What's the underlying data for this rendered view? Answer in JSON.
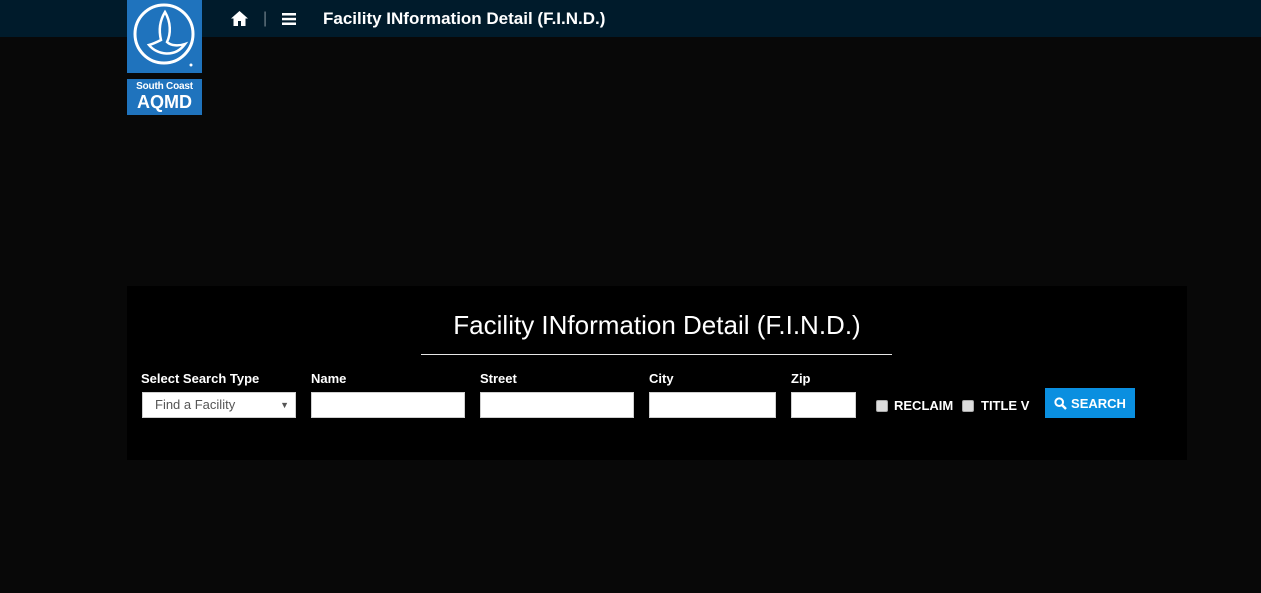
{
  "header": {
    "title": "Facility INformation Detail (F.I.N.D.)",
    "separator": "|",
    "logo": {
      "line1": "South Coast",
      "line2": "AQMD"
    }
  },
  "panel": {
    "title": "Facility INformation Detail (F.I.N.D.)",
    "fields": {
      "search_type": {
        "label": "Select Search Type",
        "value": "Find a Facility"
      },
      "name": {
        "label": "Name",
        "value": ""
      },
      "street": {
        "label": "Street",
        "value": ""
      },
      "city": {
        "label": "City",
        "value": ""
      },
      "zip": {
        "label": "Zip",
        "value": ""
      }
    },
    "checkboxes": [
      {
        "label": "RECLAIM",
        "checked": false
      },
      {
        "label": "TITLE V",
        "checked": false
      }
    ],
    "search_button": "SEARCH"
  },
  "colors": {
    "accent": "#0a8fe0",
    "header_bg": "#001b2b",
    "logo_blue": "#1f73bd"
  }
}
